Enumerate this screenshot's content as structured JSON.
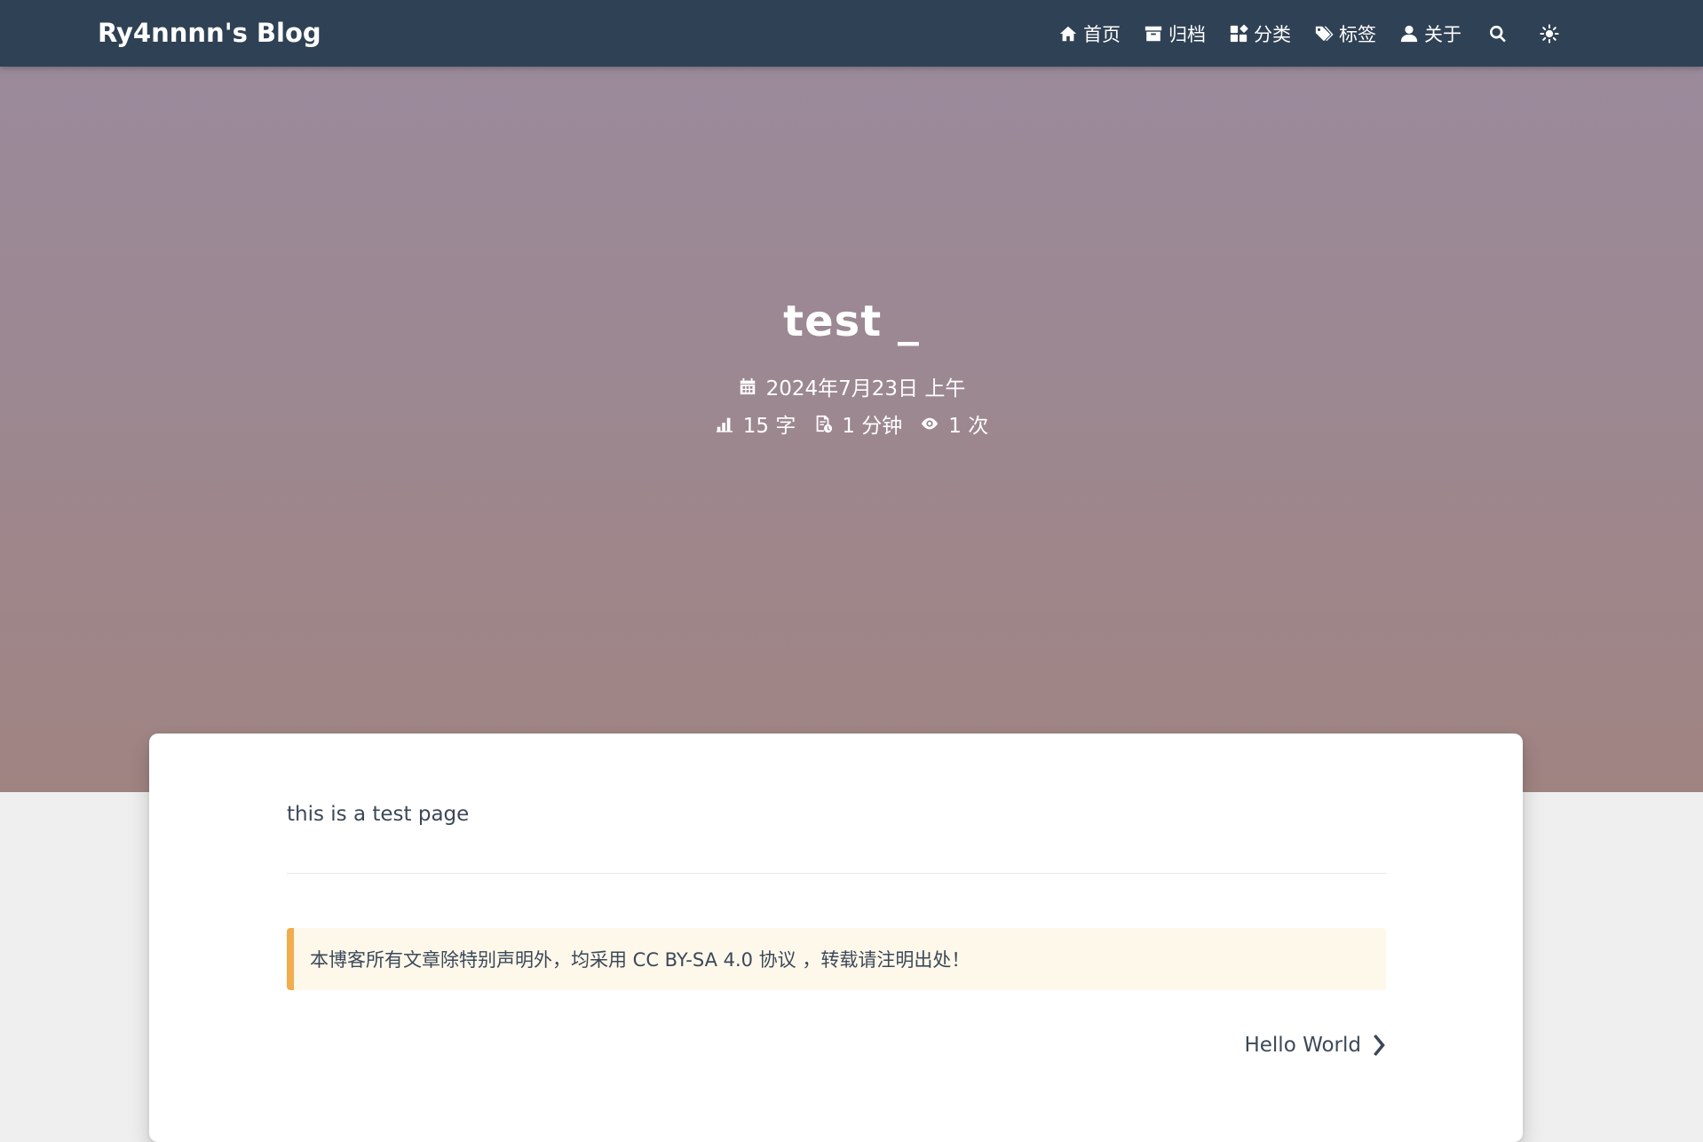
{
  "nav": {
    "brand": "Ry4nnnn's Blog",
    "items": [
      {
        "label": "首页",
        "icon": "home-icon"
      },
      {
        "label": "归档",
        "icon": "archive-icon"
      },
      {
        "label": "分类",
        "icon": "category-icon"
      },
      {
        "label": "标签",
        "icon": "tags-icon"
      },
      {
        "label": "关于",
        "icon": "user-icon"
      }
    ],
    "search_icon": "search-icon",
    "theme_icon": "sun-icon"
  },
  "banner": {
    "title": "test _",
    "date": "2024年7月23日 上午",
    "word_count": "15 字",
    "read_time": "1 分钟",
    "views": "1 次"
  },
  "post": {
    "body": "this is a test page",
    "license_note": "本博客所有文章除特别声明外，均采用 CC BY-SA 4.0 协议 ，转载请注明出处！",
    "next_post": "Hello World"
  },
  "colors": {
    "navbar": "#2f4154",
    "note_border": "#f0ad4e",
    "note_bg": "#fdf8ea"
  }
}
